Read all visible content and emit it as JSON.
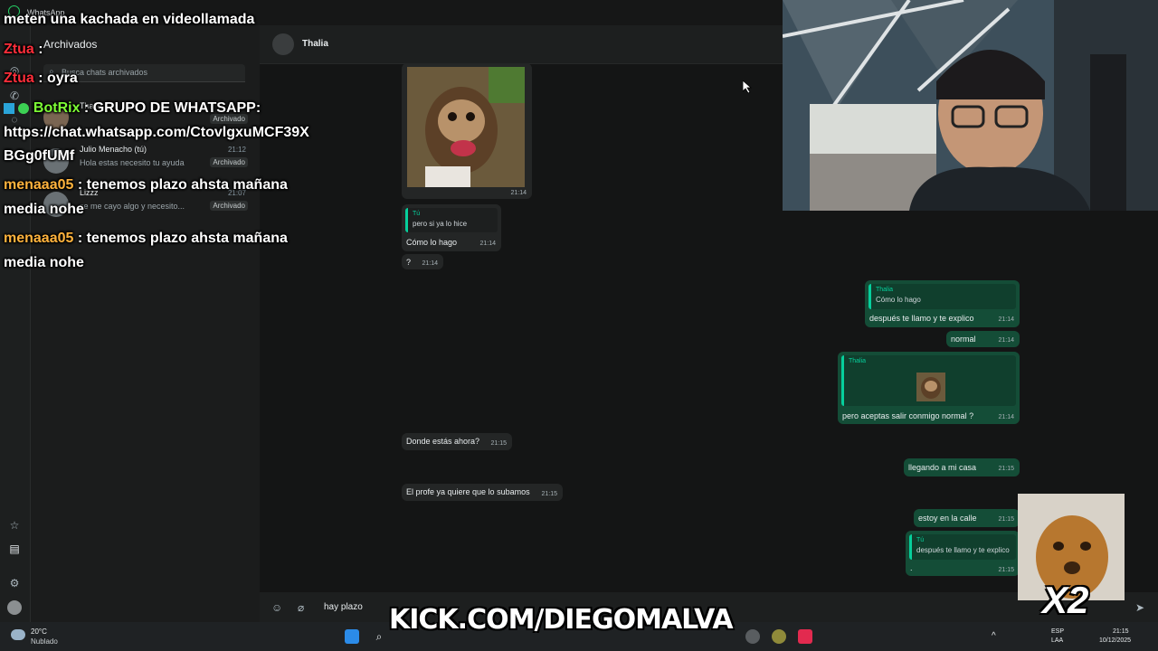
{
  "app": {
    "title": "WhatsApp"
  },
  "sidebar": {
    "header": "Archivados",
    "search_placeholder": "Busca chats archivados",
    "chats": [
      {
        "name": "Thalia",
        "time": "",
        "message": "",
        "badge": "Archivado"
      },
      {
        "name": "Julio Menacho (tú)",
        "time": "21:12",
        "message": "Hola estas necesito tu ayuda",
        "badge": "Archivado"
      },
      {
        "name": "Lizzz",
        "time": "21:07",
        "message": "se me cayo algo y necesito...",
        "badge": "Archivado"
      }
    ]
  },
  "conversation": {
    "contact_name": "Thalia",
    "messages": [
      {
        "direction": "in",
        "type": "image",
        "image": "monkey-photo",
        "time": "21:14"
      },
      {
        "direction": "in",
        "quote_name": "Tú",
        "quote_text": "pero si ya lo hice",
        "text": "Cómo lo hago",
        "time": "21:14"
      },
      {
        "direction": "in",
        "text": "?",
        "time": "21:14"
      },
      {
        "direction": "out",
        "quote_name": "Thalia",
        "quote_text": "Cómo lo hago",
        "text": "después te llamo y te explico",
        "time": "21:14"
      },
      {
        "direction": "out",
        "text": "normal",
        "time": "21:14"
      },
      {
        "direction": "out",
        "quote_name": "Thalia",
        "quote_image": "monkey-sticker",
        "text": "pero aceptas salir conmigo normal ?",
        "time": "21:14"
      },
      {
        "direction": "in",
        "text": "Donde estás ahora?",
        "time": "21:15"
      },
      {
        "direction": "out",
        "text": "llegando a mi casa",
        "time": "21:15"
      },
      {
        "direction": "in",
        "text": "El profe ya quiere que lo subamos",
        "time": "21:15"
      },
      {
        "direction": "out",
        "text": "estoy en la calle",
        "time": "21:15"
      },
      {
        "direction": "out",
        "quote_name": "Tú",
        "quote_text": "después te llamo y te explico",
        "text": ".",
        "time": "21:15"
      }
    ],
    "composer_text": "hay plazo"
  },
  "stream_chat": [
    {
      "user": "",
      "message": "meten una kachada en videollamada"
    },
    {
      "user": "Ztua",
      "message": ""
    },
    {
      "user": "Ztua",
      "message": "oyra"
    },
    {
      "user": "BotRix",
      "message": "GRUPO DE WHATSAPP:"
    },
    {
      "user": "",
      "message": "https://chat.whatsapp.com/Ctovlgxu​MCF39X"
    },
    {
      "user": "",
      "message": "BGg0fUMf"
    },
    {
      "user": "menaaa05",
      "message": "tenemos plazo ahsta mañana"
    },
    {
      "user": "",
      "message": "media nohe"
    },
    {
      "user": "menaaa05",
      "message": "tenemos plazo ahsta mañana"
    },
    {
      "user": "",
      "message": "media nohe"
    }
  ],
  "overlay": {
    "kick_url": "KICK.COM/DIEGOMALVA",
    "multiplier": "X2"
  },
  "taskbar": {
    "weather_temp": "20°C",
    "weather_cond": "Nublado",
    "lang_1": "ESP",
    "lang_2": "LAA",
    "time": "21:15",
    "date": "10/12/2025"
  },
  "colors": {
    "accent": "#06cf9c",
    "outgoing_bubble": "#144d37",
    "incoming_bubble": "#242626"
  }
}
